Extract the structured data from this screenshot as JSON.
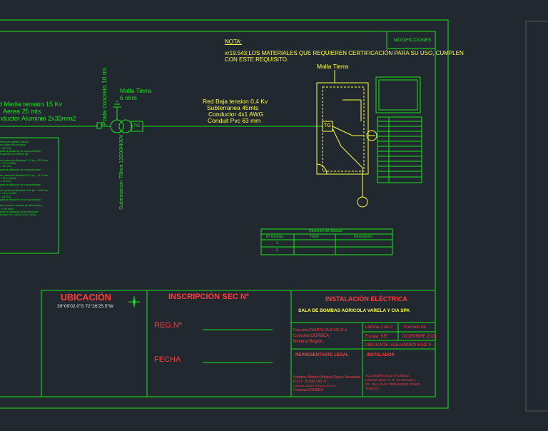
{
  "colors": {
    "background": "#212830",
    "frame": "#19e619",
    "title_red": "#ff3b3b",
    "accent_yellow": "#ffff40",
    "accent_cyan": "#3fd0ff"
  },
  "note": {
    "label": "NOTA:",
    "line1": "xr19.543;LOS MATERIALES QUE REQUIEREN CERTIFICACIÓN PARA SU USO, CUMPLEN",
    "line2": "CON ESTE REQUISITO."
  },
  "modificaciones": "MODIFICCIONES",
  "left_labels": {
    "line1": "d Media tension 15 Kv",
    "line2": "Aerea 25 mts",
    "line3": "nductor Aluminio 2x33mm2"
  },
  "poste": "Poste concreto 10 mt.",
  "subestacion": "Subestacion 75kva 13200/400V",
  "malla_tierra_left": {
    "line1": "Malla Tierra",
    "line2": "6 ohm"
  },
  "malla_tierra_top": "Malla Tierra",
  "tg": "TG",
  "red_baja": {
    "line1": "Red Baja tension 0,4 Kv",
    "line2": "Subterranea 45mts",
    "line3": "Conductor 4x1 AWG",
    "line4": "Conduit Pvc 63 mm"
  },
  "calc_panel": {
    "title": "Resumen grafica Calculo",
    "lines": [
      "de protección principal",
      "= 94.79 A",
      "para la utilización de una protección",
      "magnética de 3X80 A fija",
      "de protección Bombas 1.10 hp = 22.38 kw",
      "= 74 fc=225W",
      "= 16.13 A",
      "para la utilización de una protección",
      "de protección Bombas 2 10 hp = 11.19 kw",
      "= 74 fc=31180",
      "= 16.07 A",
      "para la utilización de una protección",
      "de protección Bombas 3 20 hp = 14.92 kw",
      "= 74 fc=14420",
      "= 26.09 A",
      "para la utilización de una protección",
      "de la sección mínima del alimentador",
      "= 0.99 mm2",
      "para la utilización de conductores",
      "sección de 1 AWG (42.41 mm2)"
    ]
  },
  "resumen": {
    "title": "Resumen de laminas",
    "headers": [
      "Nº laminas",
      "Título",
      "Descripción"
    ],
    "rows": [
      {
        "n": "1",
        "titulo": "",
        "descripcion": ""
      },
      {
        "n": "2",
        "titulo": "",
        "descripcion": ""
      }
    ]
  },
  "title_block": {
    "ubicacion": {
      "label": "UBICACIÓN",
      "coords": "39°09'02.0\"S 72°26'25.5\"W"
    },
    "inscripcion": {
      "label": "INSCRIPCIÓN SEC Nº",
      "reg": "REG.Nº",
      "fecha": "FECHA"
    },
    "instalacion": {
      "label": "INSTALACIÓN ELÉCTRICA",
      "subtitle": "SALA DE BOMBAS AGRICOLA VARELA Y CIA SPA"
    },
    "direccion": [
      "Dirección:CUARTA FAJA KM 22,5",
      "Comuna:GORBEA",
      "Novena Región."
    ],
    "lamina": "Lámina 1 de 2",
    "formato": "Formato A3",
    "escala": "Escala: S/E",
    "fecha_plano": "DICIEMBRE 2023",
    "dibujante": "DIBUJANTE: ALEJANDRO RUIZ F.",
    "representante": {
      "label": "REPRESENTANTE LEGAL",
      "lines": [
        "Nombre: Marisol Adriana Reyes Navarrete",
        "R.U.T: 10.642.043--9",
        "Dirección:CUARTA FAJA KM 22,5",
        "Comuna:GORBEA"
      ]
    },
    "instalador": {
      "label": "INSTALADOR",
      "lines": [
        "ALEJANDRO RUIZ FAUNDEZ",
        "Licencia clase \"A\" Nº 14.219.318-1",
        "DR. ISLA JUAN FERNANDEZ #03660",
        "TEMUCO"
      ]
    }
  }
}
